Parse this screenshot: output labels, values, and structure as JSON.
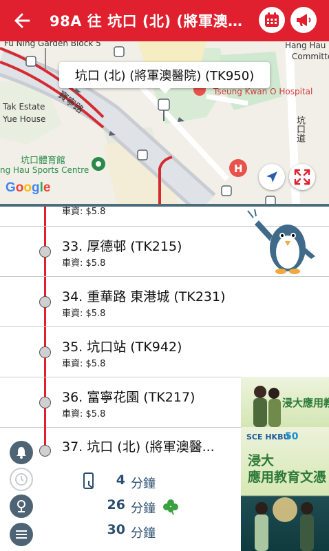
{
  "header": {
    "title": "98A 往 坑口 (北) (將軍澳醫...",
    "back_icon": "arrow-left-icon",
    "calendar_icon": "calendar-icon",
    "announce_icon": "megaphone-icon",
    "bg_color": "#e0202e"
  },
  "map": {
    "tooltip": "坑口 (北) (將軍澳醫院) (TK950)",
    "labels": {
      "fu_ning": "Fu Ning Garden Block 5",
      "hang_hau_r": "Hang Hau R",
      "committe": "Committe",
      "tseung_kwan_o_hospital": "Tseung Kwan O Hospital",
      "tak_estate": "Tak Estate",
      "yue_house": "Yue House",
      "road_bao_ning": "寶寧路",
      "road_hang_hau": "坑口道",
      "sports_centre_zh": "坑口體育館",
      "sports_centre_en": "ng Hau Sports Centre"
    },
    "google": "Google",
    "locate_icon": "navigation-arrow-icon",
    "expand_icon": "expand-arrows-icon"
  },
  "stops": {
    "partial_fare": "車資: $5.8",
    "items": [
      {
        "label": "33. 厚德邨 (TK215)",
        "fare": "車資: $5.8"
      },
      {
        "label": "34. 重華路 東港城 (TK231)",
        "fare": "車資: $5.8"
      },
      {
        "label": "35. 坑口站 (TK942)",
        "fare": "車資: $5.8"
      },
      {
        "label": "36. 富寧花園 (TK217)",
        "fare": "車資: $5.8"
      }
    ],
    "last": {
      "label": "37. 坑口 (北) (將軍澳醫...",
      "eta": [
        {
          "minutes": "4",
          "unit": "分鐘",
          "icon": "phone-schedule-icon"
        },
        {
          "minutes": "26",
          "unit": "分鐘",
          "icon": "clover-icon"
        },
        {
          "minutes": "30",
          "unit": "分鐘"
        }
      ],
      "side_icons": [
        "bell-icon",
        "clock-icon",
        "pin-icon",
        "menu-icon"
      ]
    }
  },
  "ads": {
    "ad1_text": "浸大應用教育文憑",
    "ad2_logo": "SCE HKBU",
    "ad2_badge": "50",
    "ad2_line1": "浸大",
    "ad2_line2": "應用教育文憑"
  }
}
